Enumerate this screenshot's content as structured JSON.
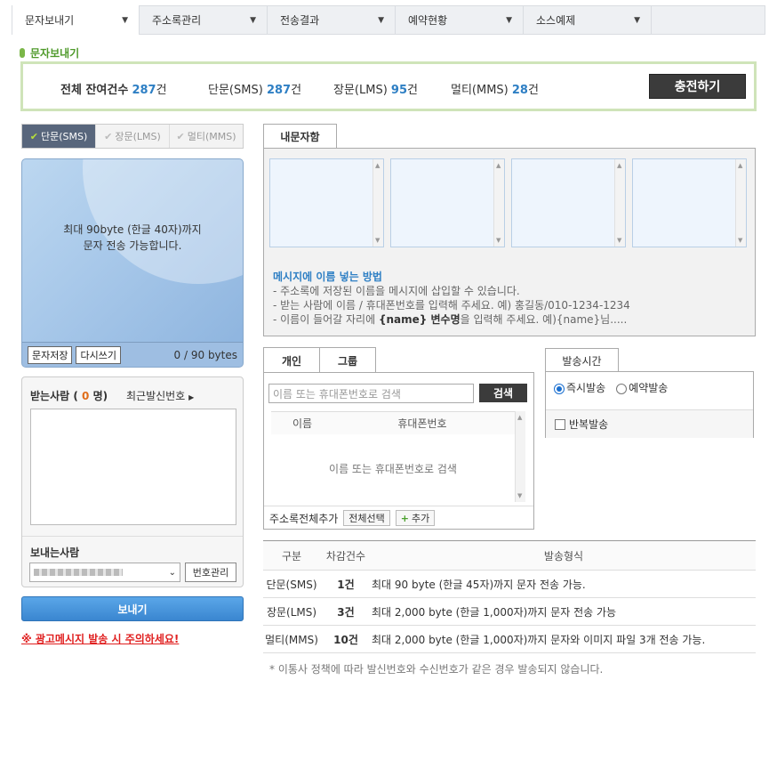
{
  "nav": [
    {
      "label": "문자보내기",
      "active": true
    },
    {
      "label": "주소록관리",
      "active": false
    },
    {
      "label": "전송결과",
      "active": false
    },
    {
      "label": "예약현황",
      "active": false
    },
    {
      "label": "소스예제",
      "active": false
    }
  ],
  "section_title": "문자보내기",
  "balance": {
    "total_label": "전체 잔여건수",
    "total": "287",
    "sms_label": "단문(SMS)",
    "sms": "287",
    "lms_label": "장문(LMS)",
    "lms": "95",
    "mms_label": "멀티(MMS)",
    "mms": "28",
    "unit": "건",
    "charge_button": "충전하기"
  },
  "msg_tabs": [
    "단문(SMS)",
    "장문(LMS)",
    "멀티(MMS)"
  ],
  "phone": {
    "hint_line1": "최대 90byte (한글 40자)까지",
    "hint_line2": "문자 전송 가능합니다.",
    "save_button": "문자저장",
    "rewrite_button": "다시쓰기",
    "bytes": "0 / 90 bytes"
  },
  "receivers": {
    "label": "받는사람",
    "count": "0",
    "unit": "명",
    "recent_label": "최근발신번호"
  },
  "sender": {
    "label": "보내는사람",
    "manage_button": "번호관리"
  },
  "send_button": "보내기",
  "warning": "※ 광고메시지 발송 시 주의하세요!",
  "my_box": {
    "tab": "내문자함",
    "how_title": "메시지에 이름 넣는 방법",
    "how_line1": "- 주소록에 저장된 이름을 메시지에 삽입할 수 있습니다.",
    "how_line2": "- 받는 사람에 이름 / 휴대폰번호를 입력해 주세요. 예) 홍길동/010-1234-1234",
    "how_line3_pre": "- 이름이 들어갈 자리에 ",
    "how_line3_var": "{name} 변수명",
    "how_line3_post": "을 입력해 주세요. 예){name}님....."
  },
  "group": {
    "tabs": [
      "개인",
      "그룹"
    ],
    "search_placeholder": "이름 또는 휴대폰번호로 검색",
    "search_button": "검색",
    "col_name": "이름",
    "col_phone": "휴대폰번호",
    "empty_text": "이름 또는 휴대폰번호로 검색",
    "add_all_label": "주소록전체추가",
    "select_all_button": "전체선택",
    "add_button": "추가"
  },
  "send_time": {
    "tab": "발송시간",
    "immediate": "즉시발송",
    "reserve": "예약발송",
    "repeat": "반복발송"
  },
  "format_table": {
    "headers": [
      "구분",
      "차감건수",
      "발송형식"
    ],
    "rows": [
      [
        "단문(SMS)",
        "1건",
        "최대 90 byte (한글 45자)까지 문자 전송 가능."
      ],
      [
        "장문(LMS)",
        "3건",
        "최대 2,000 byte (한글 1,000자)까지 문자 전송 가능"
      ],
      [
        "멀티(MMS)",
        "10건",
        "최대 2,000 byte (한글 1,000자)까지 문자와 이미지 파일 3개 전송 가능."
      ]
    ]
  },
  "note": "* 이통사 정책에 따라 발신번호와 수신번호가 같은 경우 발송되지 않습니다."
}
